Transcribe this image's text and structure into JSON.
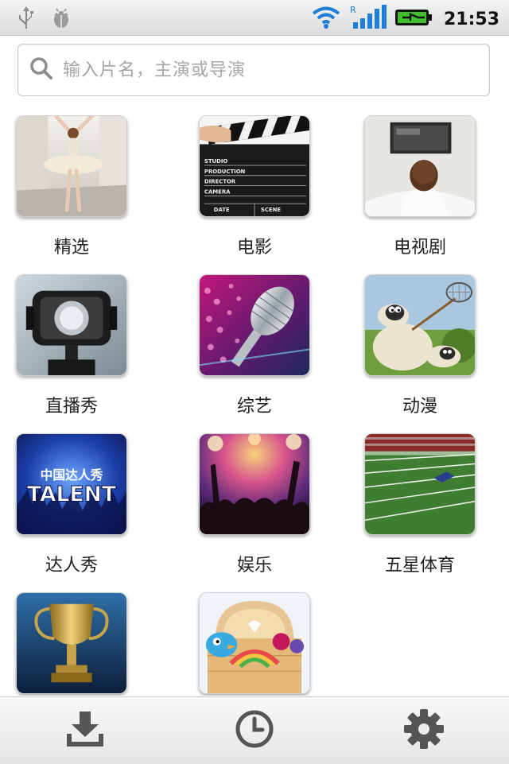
{
  "status_bar": {
    "time": "21:53",
    "icons": [
      "usb-icon",
      "debug-icon",
      "wifi-icon",
      "signal-icon",
      "battery-charging-icon"
    ],
    "signal_tag": "R"
  },
  "search": {
    "placeholder": "输入片名，主演或导演",
    "icon": "search-icon"
  },
  "categories": [
    {
      "label": "精选",
      "image": "ballerina"
    },
    {
      "label": "电影",
      "image": "clapperboard"
    },
    {
      "label": "电视剧",
      "image": "tv-watcher"
    },
    {
      "label": "直播秀",
      "image": "broadcast-camera"
    },
    {
      "label": "综艺",
      "image": "microphone"
    },
    {
      "label": "动漫",
      "image": "cartoon-sheep"
    },
    {
      "label": "达人秀",
      "image": "talent-show",
      "image_text_top": "中国达人秀",
      "image_text_bottom": "TALENT"
    },
    {
      "label": "娱乐",
      "image": "concert"
    },
    {
      "label": "五星体育",
      "image": "football-field"
    },
    {
      "label": "",
      "image": "trophy"
    },
    {
      "label": "",
      "image": "kids-toys"
    }
  ],
  "clapperboard_text": [
    "STUDIO",
    "PRODUCTION",
    "DIRECTOR",
    "CAMERA",
    "DATE",
    "SCENE"
  ],
  "bottom_bar": {
    "items": [
      "download-icon",
      "history-icon",
      "settings-icon"
    ]
  }
}
